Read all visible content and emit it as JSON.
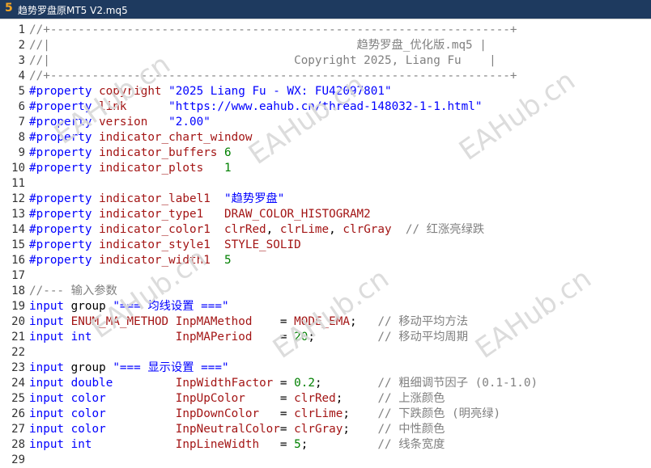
{
  "window": {
    "tab_number": "5",
    "title": "趋势罗盘原MT5 V2.mq5"
  },
  "watermark": {
    "text": "EAHub.cn"
  },
  "code": {
    "lines": [
      {
        "n": "1",
        "tokens": [
          {
            "t": "//+------------------------------------------------------------------+",
            "c": "comment"
          }
        ]
      },
      {
        "n": "2",
        "tokens": [
          {
            "t": "//|                                            趋势罗盘_优化版.mq5 |",
            "c": "comment"
          }
        ]
      },
      {
        "n": "3",
        "tokens": [
          {
            "t": "//|                                   Copyright 2025, Liang Fu    |",
            "c": "comment"
          }
        ]
      },
      {
        "n": "4",
        "tokens": [
          {
            "t": "//+------------------------------------------------------------------+",
            "c": "comment"
          }
        ]
      },
      {
        "n": "5",
        "tokens": [
          {
            "t": "#property",
            "c": "pre"
          },
          {
            "t": " copyright ",
            "c": "prop"
          },
          {
            "t": "\"2025 Liang Fu - WX: FU42097801\"",
            "c": "str"
          }
        ]
      },
      {
        "n": "6",
        "tokens": [
          {
            "t": "#property",
            "c": "pre"
          },
          {
            "t": " link      ",
            "c": "prop"
          },
          {
            "t": "\"https://www.eahub.cn/thread-148032-1-1.html\"",
            "c": "str"
          }
        ]
      },
      {
        "n": "7",
        "tokens": [
          {
            "t": "#property",
            "c": "pre"
          },
          {
            "t": " version   ",
            "c": "prop"
          },
          {
            "t": "\"2.00\"",
            "c": "str"
          }
        ]
      },
      {
        "n": "8",
        "tokens": [
          {
            "t": "#property",
            "c": "pre"
          },
          {
            "t": " indicator_chart_window",
            "c": "prop"
          }
        ]
      },
      {
        "n": "9",
        "tokens": [
          {
            "t": "#property",
            "c": "pre"
          },
          {
            "t": " indicator_buffers ",
            "c": "prop"
          },
          {
            "t": "6",
            "c": "num"
          }
        ]
      },
      {
        "n": "10",
        "tokens": [
          {
            "t": "#property",
            "c": "pre"
          },
          {
            "t": " indicator_plots   ",
            "c": "prop"
          },
          {
            "t": "1",
            "c": "num"
          }
        ]
      },
      {
        "n": "11",
        "tokens": [
          {
            "t": "",
            "c": "plain"
          }
        ]
      },
      {
        "n": "12",
        "tokens": [
          {
            "t": "#property",
            "c": "pre"
          },
          {
            "t": " indicator_label1  ",
            "c": "prop"
          },
          {
            "t": "\"趋势罗盘\"",
            "c": "str"
          }
        ]
      },
      {
        "n": "13",
        "tokens": [
          {
            "t": "#property",
            "c": "pre"
          },
          {
            "t": " indicator_type1   ",
            "c": "prop"
          },
          {
            "t": "DRAW_COLOR_HISTOGRAM2",
            "c": "const"
          }
        ]
      },
      {
        "n": "14",
        "tokens": [
          {
            "t": "#property",
            "c": "pre"
          },
          {
            "t": " indicator_color1  ",
            "c": "prop"
          },
          {
            "t": "clrRed",
            "c": "const"
          },
          {
            "t": ", ",
            "c": "plain"
          },
          {
            "t": "clrLime",
            "c": "const"
          },
          {
            "t": ", ",
            "c": "plain"
          },
          {
            "t": "clrGray",
            "c": "const"
          },
          {
            "t": "  // 红涨亮绿跌",
            "c": "comment"
          }
        ]
      },
      {
        "n": "15",
        "tokens": [
          {
            "t": "#property",
            "c": "pre"
          },
          {
            "t": " indicator_style1  ",
            "c": "prop"
          },
          {
            "t": "STYLE_SOLID",
            "c": "const"
          }
        ]
      },
      {
        "n": "16",
        "tokens": [
          {
            "t": "#property",
            "c": "pre"
          },
          {
            "t": " indicator_width1  ",
            "c": "prop"
          },
          {
            "t": "5",
            "c": "num"
          }
        ]
      },
      {
        "n": "17",
        "tokens": [
          {
            "t": "",
            "c": "plain"
          }
        ]
      },
      {
        "n": "18",
        "tokens": [
          {
            "t": "//--- 输入参数",
            "c": "comment"
          }
        ]
      },
      {
        "n": "19",
        "tokens": [
          {
            "t": "input",
            "c": "kw"
          },
          {
            "t": " group ",
            "c": "plain"
          },
          {
            "t": "\"=== 均线设置 ===\"",
            "c": "str"
          }
        ]
      },
      {
        "n": "20",
        "tokens": [
          {
            "t": "input",
            "c": "kw"
          },
          {
            "t": " ENUM_MA_METHOD ",
            "c": "type"
          },
          {
            "t": "InpMAMethod    ",
            "c": "ident"
          },
          {
            "t": "= ",
            "c": "plain"
          },
          {
            "t": "MODE_EMA",
            "c": "const"
          },
          {
            "t": ";   ",
            "c": "plain"
          },
          {
            "t": "// 移动平均方法",
            "c": "comment"
          }
        ]
      },
      {
        "n": "21",
        "tokens": [
          {
            "t": "input",
            "c": "kw"
          },
          {
            "t": " int            ",
            "c": "kw"
          },
          {
            "t": "InpMAPeriod    ",
            "c": "ident"
          },
          {
            "t": "= ",
            "c": "plain"
          },
          {
            "t": "20",
            "c": "num"
          },
          {
            "t": ";         ",
            "c": "plain"
          },
          {
            "t": "// 移动平均周期",
            "c": "comment"
          }
        ]
      },
      {
        "n": "22",
        "tokens": [
          {
            "t": "",
            "c": "plain"
          }
        ]
      },
      {
        "n": "23",
        "tokens": [
          {
            "t": "input",
            "c": "kw"
          },
          {
            "t": " group ",
            "c": "plain"
          },
          {
            "t": "\"=== 显示设置 ===\"",
            "c": "str"
          }
        ]
      },
      {
        "n": "24",
        "tokens": [
          {
            "t": "input",
            "c": "kw"
          },
          {
            "t": " double         ",
            "c": "kw"
          },
          {
            "t": "InpWidthFactor ",
            "c": "ident"
          },
          {
            "t": "= ",
            "c": "plain"
          },
          {
            "t": "0.2",
            "c": "num"
          },
          {
            "t": ";        ",
            "c": "plain"
          },
          {
            "t": "// 粗细调节因子 (0.1-1.0)",
            "c": "comment"
          }
        ]
      },
      {
        "n": "25",
        "tokens": [
          {
            "t": "input",
            "c": "kw"
          },
          {
            "t": " color          ",
            "c": "kw"
          },
          {
            "t": "InpUpColor     ",
            "c": "ident"
          },
          {
            "t": "= ",
            "c": "plain"
          },
          {
            "t": "clrRed",
            "c": "const"
          },
          {
            "t": ";     ",
            "c": "plain"
          },
          {
            "t": "// 上涨颜色",
            "c": "comment"
          }
        ]
      },
      {
        "n": "26",
        "tokens": [
          {
            "t": "input",
            "c": "kw"
          },
          {
            "t": " color          ",
            "c": "kw"
          },
          {
            "t": "InpDownColor   ",
            "c": "ident"
          },
          {
            "t": "= ",
            "c": "plain"
          },
          {
            "t": "clrLime",
            "c": "const"
          },
          {
            "t": ";    ",
            "c": "plain"
          },
          {
            "t": "// 下跌颜色 (明亮绿)",
            "c": "comment"
          }
        ]
      },
      {
        "n": "27",
        "tokens": [
          {
            "t": "input",
            "c": "kw"
          },
          {
            "t": " color          ",
            "c": "kw"
          },
          {
            "t": "InpNeutralColor",
            "c": "ident"
          },
          {
            "t": "= ",
            "c": "plain"
          },
          {
            "t": "clrGray",
            "c": "const"
          },
          {
            "t": ";    ",
            "c": "plain"
          },
          {
            "t": "// 中性颜色",
            "c": "comment"
          }
        ]
      },
      {
        "n": "28",
        "tokens": [
          {
            "t": "input",
            "c": "kw"
          },
          {
            "t": " int            ",
            "c": "kw"
          },
          {
            "t": "InpLineWidth   ",
            "c": "ident"
          },
          {
            "t": "= ",
            "c": "plain"
          },
          {
            "t": "5",
            "c": "num"
          },
          {
            "t": ";          ",
            "c": "plain"
          },
          {
            "t": "// 线条宽度",
            "c": "comment"
          }
        ]
      },
      {
        "n": "29",
        "tokens": [
          {
            "t": "",
            "c": "plain"
          }
        ]
      }
    ]
  }
}
